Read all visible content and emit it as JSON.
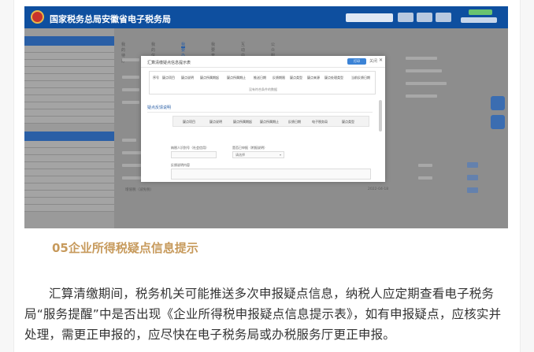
{
  "screenshot": {
    "header": {
      "site_title": "国家税务总局安徽省电子税务局"
    },
    "tabs": [
      "我的待办",
      "我的信息",
      "我要办税",
      "我要查询",
      "互动中心",
      "公众服务"
    ],
    "modal": {
      "title": "汇算清缴疑点信息提示表",
      "action_button": "打印",
      "close_label": "关闭",
      "table1_headers": [
        "序号",
        "疑点项目",
        "疑点说明",
        "疑点所属期起",
        "疑点所属期止",
        "推送日期",
        "反馈期限",
        "疑点类型",
        "疑点来源",
        "疑点处理类型",
        "当前反馈日期"
      ],
      "table1_empty": "没有符合条件的数据",
      "section_label": "疑点反馈说明",
      "table2_headers": [
        "疑点项目",
        "疑点说明",
        "疑点所属期起",
        "疑点所属期止",
        "反馈日期",
        "电子税务局",
        "疑点类型"
      ],
      "fields": {
        "credit_code_label": "纳税人识别号（社会信用）",
        "apply_label": "是否已申报（附报说明）",
        "apply_value": "请选择",
        "note_label": "反馈说明内容"
      }
    },
    "background_rows": {
      "date": "2022-04-18",
      "row_label": "增值税（减免税）"
    },
    "colors": {
      "header_blue": "#0e4f9f",
      "accent_blue": "#2a5fa6"
    }
  },
  "article": {
    "section_title": "05企业所得税疑点信息提示",
    "paragraph": "汇算清缴期间，税务机关可能推送多次申报疑点信息，纳税人应定期查看电子税务局“服务提醒”中是否出现《企业所得税申报疑点信息提示表》，如有申报疑点，应核实并处理，需更正申报的，应尽快在电子税务局或办税服务厅更正申报。"
  }
}
